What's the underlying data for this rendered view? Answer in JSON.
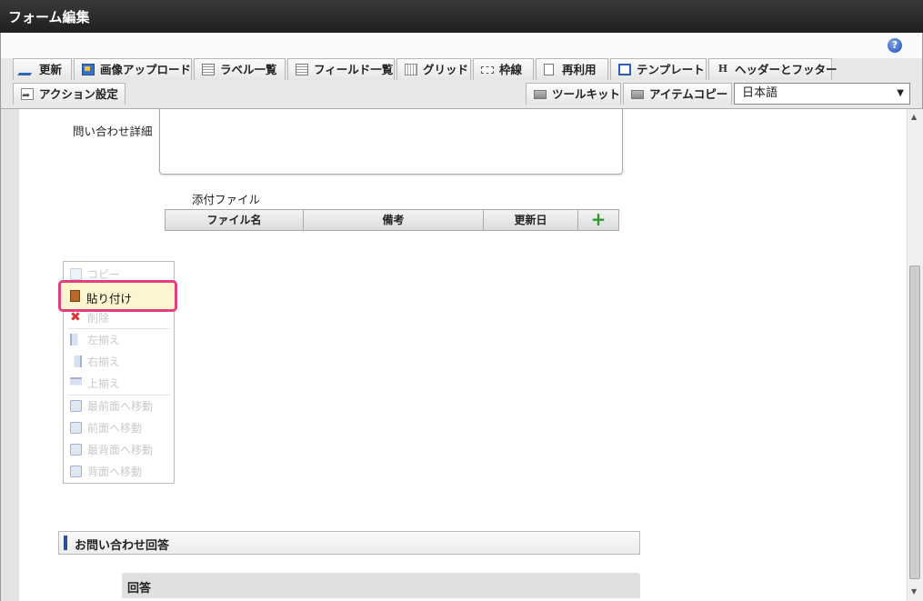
{
  "window": {
    "title": "フォーム編集",
    "help": "?"
  },
  "toolbar": {
    "row1": [
      {
        "label": "更新",
        "icon": "pencil-icon"
      },
      {
        "label": "画像アップロード",
        "icon": "image-icon"
      },
      {
        "label": "ラベル一覧",
        "icon": "list-icon"
      },
      {
        "label": "フィールド一覧",
        "icon": "list-icon"
      },
      {
        "label": "グリッド",
        "icon": "grid-icon"
      },
      {
        "label": "枠線",
        "icon": "frame-icon"
      },
      {
        "label": "再利用",
        "icon": "document-icon"
      },
      {
        "label": "テンプレート",
        "icon": "template-icon"
      },
      {
        "label": "ヘッダーとフッター",
        "icon": "h-icon"
      }
    ],
    "action_settings": "アクション設定",
    "toolkit": "ツールキット",
    "item_copy": "アイテムコピー",
    "language": "日本語"
  },
  "form": {
    "inquiry_detail_label": "問い合わせ詳細",
    "attachments": {
      "label": "添付ファイル",
      "columns": [
        "ファイル名",
        "備考",
        "更新日"
      ],
      "add": "+"
    },
    "section_title": "お問い合わせ回答",
    "answer_label": "回答"
  },
  "context_menu": {
    "items": [
      {
        "label": "コピー",
        "enabled": false,
        "icon": "copy-icon"
      },
      {
        "label": "貼り付け",
        "enabled": true,
        "highlighted": true,
        "icon": "paste-icon"
      },
      {
        "label": "削除",
        "enabled": false,
        "icon": "delete-icon"
      },
      {
        "label": "左揃え",
        "enabled": false,
        "icon": "align-left-icon"
      },
      {
        "label": "右揃え",
        "enabled": false,
        "icon": "align-right-icon"
      },
      {
        "label": "上揃え",
        "enabled": false,
        "icon": "align-top-icon"
      },
      {
        "label": "最前面へ移動",
        "enabled": false,
        "icon": "bring-to-front-icon"
      },
      {
        "label": "前面へ移動",
        "enabled": false,
        "icon": "bring-forward-icon"
      },
      {
        "label": "最背面へ移動",
        "enabled": false,
        "icon": "send-to-back-icon"
      },
      {
        "label": "背面へ移動",
        "enabled": false,
        "icon": "send-backward-icon"
      }
    ]
  },
  "colors": {
    "highlight_border": "#e0407e",
    "highlight_fill": "#fdf5cf",
    "accent": "#2a4f9e",
    "add_green": "#2e9a2e"
  }
}
